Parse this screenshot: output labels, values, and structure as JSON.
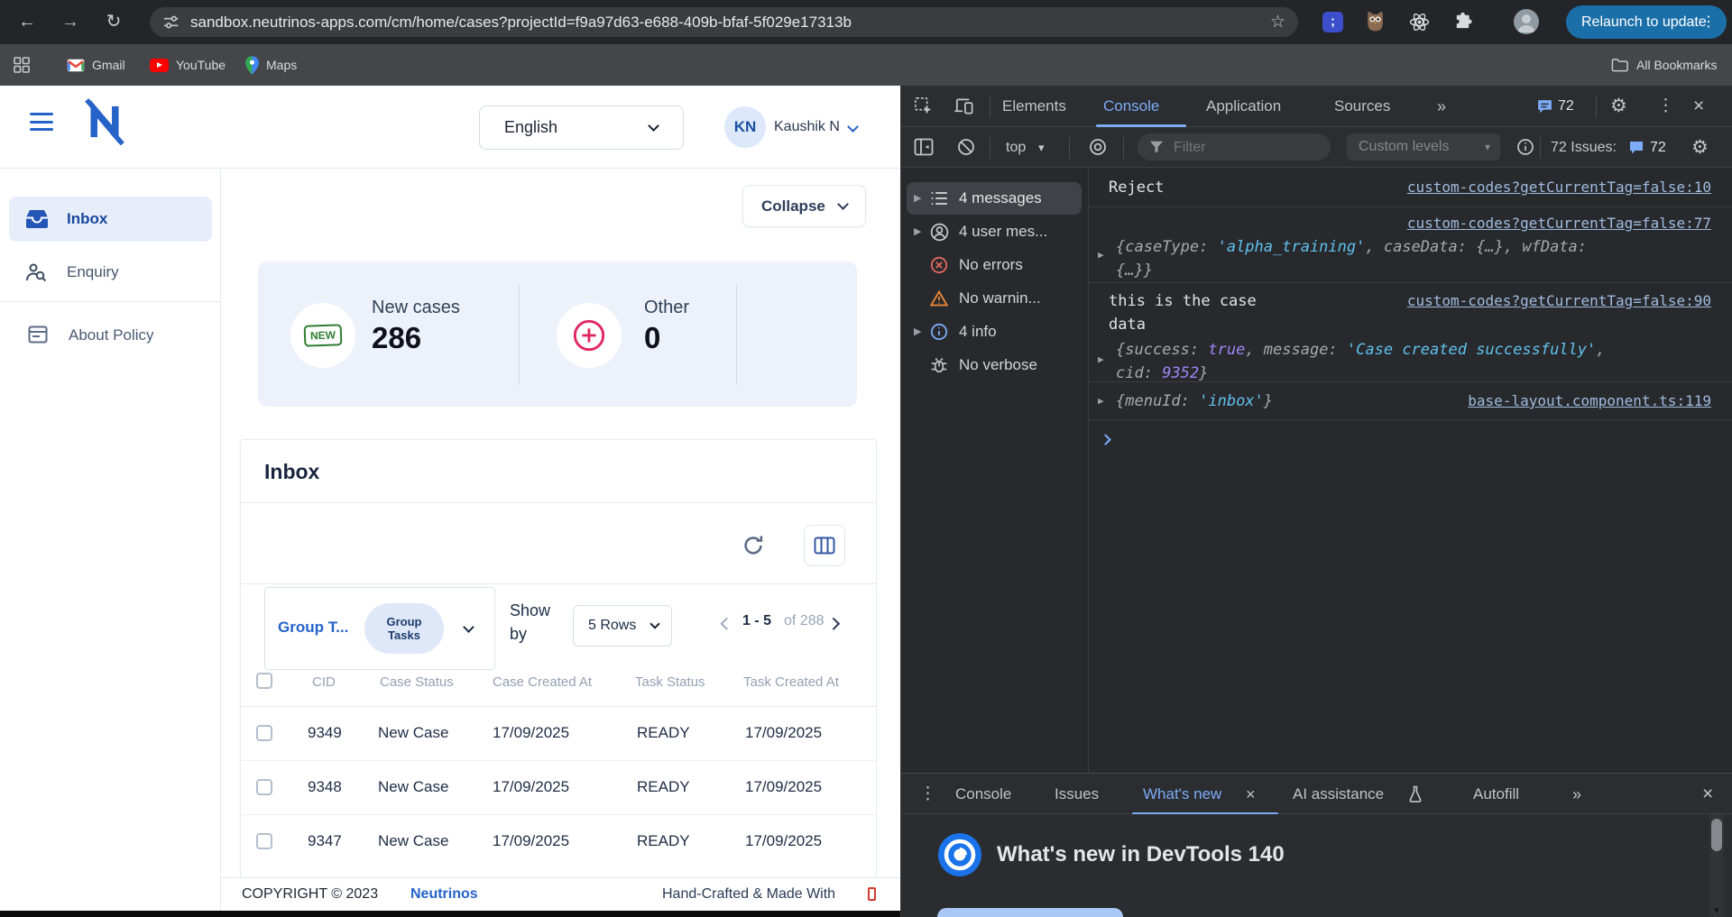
{
  "icons": {
    "back": "←",
    "forward": "→",
    "reload": "↻",
    "star": "☆",
    "semicolon": ";",
    "overflow": "⋮",
    "close": "×",
    "more_tabs": "»",
    "caret": "▾",
    "expand": "▶",
    "gear": "⚙"
  },
  "browser": {
    "url": "sandbox.neutrinos-apps.com/cm/home/cases?projectId=f9a97d63-e688-409b-bfaf-5f029e17313b",
    "relaunch_label": "Relaunch to update",
    "bookmarks": {
      "gmail": "Gmail",
      "youtube": "YouTube",
      "maps": "Maps"
    },
    "all_bookmarks": "All Bookmarks"
  },
  "app": {
    "language": "English",
    "user": {
      "initials": "KN",
      "name": "Kaushik N"
    },
    "sidebar": {
      "inbox": "Inbox",
      "enquiry": "Enquiry",
      "about_policy": "About Policy"
    },
    "collapse": "Collapse",
    "stats": {
      "new_badge": "NEW",
      "new_cases_label": "New cases",
      "new_cases_value": "286",
      "other_label": "Other",
      "other_value": "0"
    },
    "inbox_panel": {
      "title": "Inbox",
      "group_label": "Group T...",
      "group_chip_line1": "Group",
      "group_chip_line2": "Tasks",
      "show_by_line1": "Show",
      "show_by_line2": "by",
      "rows_per_page": "5 Rows",
      "page_range": "1 - 5",
      "page_of": "of 288",
      "headers": {
        "cid": "CID",
        "case_status": "Case Status",
        "case_created": "Case Created At",
        "task_status": "Task Status",
        "task_created": "Task Created At"
      },
      "rows": [
        {
          "cid": "9349",
          "case_status": "New Case",
          "case_created": "17/09/2025",
          "task_status": "READY",
          "task_created": "17/09/2025"
        },
        {
          "cid": "9348",
          "case_status": "New Case",
          "case_created": "17/09/2025",
          "task_status": "READY",
          "task_created": "17/09/2025"
        },
        {
          "cid": "9347",
          "case_status": "New Case",
          "case_created": "17/09/2025",
          "task_status": "READY",
          "task_created": "17/09/2025"
        }
      ]
    },
    "footer": {
      "copyright": "COPYRIGHT © 2023",
      "brand": "Neutrinos",
      "tagline": "Hand-Crafted & Made With"
    }
  },
  "devtools": {
    "tabs": {
      "elements": "Elements",
      "console": "Console",
      "application": "Application",
      "sources": "Sources"
    },
    "issues_badge_top": "72",
    "toolbar": {
      "context": "top",
      "filter": "Filter",
      "levels": "Custom levels",
      "issues_label": "72 Issues:",
      "issues_badge": "72"
    },
    "side": {
      "messages": "4 messages",
      "user": "4 user mes...",
      "errors": "No errors",
      "warnings": "No warnin...",
      "info": "4 info",
      "verbose": "No verbose"
    },
    "logs": {
      "m1": {
        "text": "Reject",
        "src": "custom-codes?getCurrentTag=false:10"
      },
      "m2": {
        "src": "custom-codes?getCurrentTag=false:77",
        "a1": "{caseType: ",
        "s1": "'alpha_training'",
        "a2": ", caseData: ",
        "o1": "{…}",
        "a3": ", wfData:",
        "l2": "{…}}"
      },
      "m3": {
        "t1": "this is the case",
        "t2": "data",
        "src": "custom-codes?getCurrentTag=false:90",
        "a1": "{success: ",
        "b1": "true",
        "a2": ", message: ",
        "s1": "'Case created successfully'",
        "a3": ",",
        "l2a": "cid: ",
        "n1": "9352",
        "l2b": "}"
      },
      "m4": {
        "a1": "{menuId: ",
        "s1": "'inbox'",
        "a2": "}",
        "src": "base-layout.component.ts:119"
      }
    },
    "drawer": {
      "tabs": {
        "console": "Console",
        "issues": "Issues",
        "whats_new": "What's new",
        "ai": "AI assistance",
        "autofill": "Autofill"
      },
      "heading": "What's new in DevTools 140"
    }
  }
}
